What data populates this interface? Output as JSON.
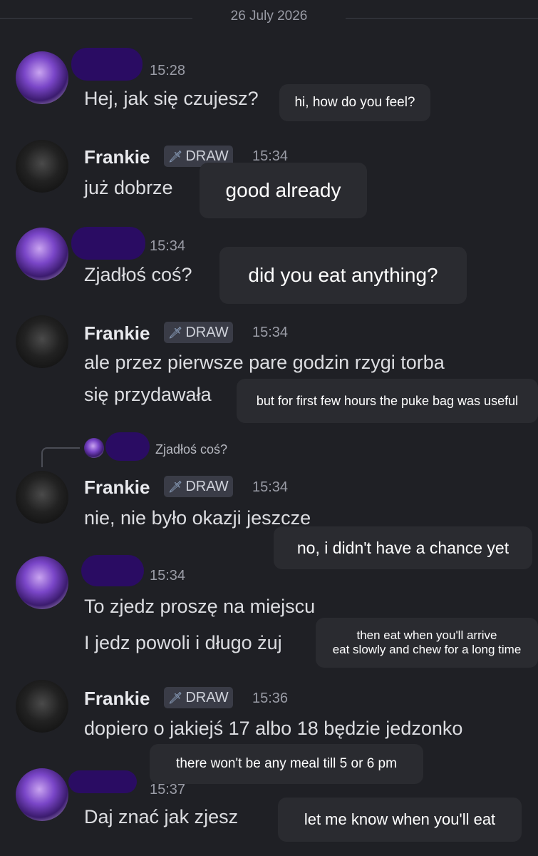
{
  "date": "26 July 2026",
  "messages": [
    {
      "author": "",
      "time": "15:28",
      "lines": [
        "Hej, jak się czujesz?"
      ],
      "translation": [
        "hi, how do you feel?"
      ]
    },
    {
      "author": "Frankie",
      "tag": "DRAW",
      "time": "15:34",
      "lines": [
        "już dobrze"
      ],
      "translation": [
        "good already"
      ]
    },
    {
      "author": "",
      "time": "15:34",
      "lines": [
        "Zjadłoś coś?"
      ],
      "translation": [
        "did you eat anything?"
      ]
    },
    {
      "author": "Frankie",
      "tag": "DRAW",
      "time": "15:34",
      "lines": [
        "ale przez pierwsze pare godzin rzygi torba",
        "się przydawała"
      ],
      "translation": [
        "but for first few hours the puke bag was useful"
      ]
    },
    {
      "author": "Frankie",
      "tag": "DRAW",
      "time": "15:34",
      "reply_to": "Zjadłoś coś?",
      "lines": [
        "nie, nie było okazji jeszcze"
      ],
      "translation": [
        "no, i didn't have a chance yet"
      ]
    },
    {
      "author": "",
      "time": "15:34",
      "lines": [
        "To zjedz proszę na miejscu",
        "I jedz powoli i długo żuj"
      ],
      "translation": [
        "then eat when you'll arrive",
        "eat slowly and chew for a long time"
      ]
    },
    {
      "author": "Frankie",
      "tag": "DRAW",
      "time": "15:36",
      "lines": [
        "dopiero o jakiejś 17 albo 18 będzie jedzonko"
      ],
      "translation": [
        "there won't be any meal till 5 or 6 pm"
      ]
    },
    {
      "author": "",
      "time": "15:37",
      "lines": [
        "Daj znać jak zjesz"
      ],
      "translation": [
        "let me know when you'll eat"
      ]
    }
  ],
  "icons": {
    "tag": "sword-icon",
    "avatar_you": "avatar-anime",
    "avatar_frankie": "avatar-dark-photo"
  },
  "colors": {
    "background": "#1f2025",
    "redaction": "#2a0c63",
    "translation_bubble": "#2a2b30"
  }
}
